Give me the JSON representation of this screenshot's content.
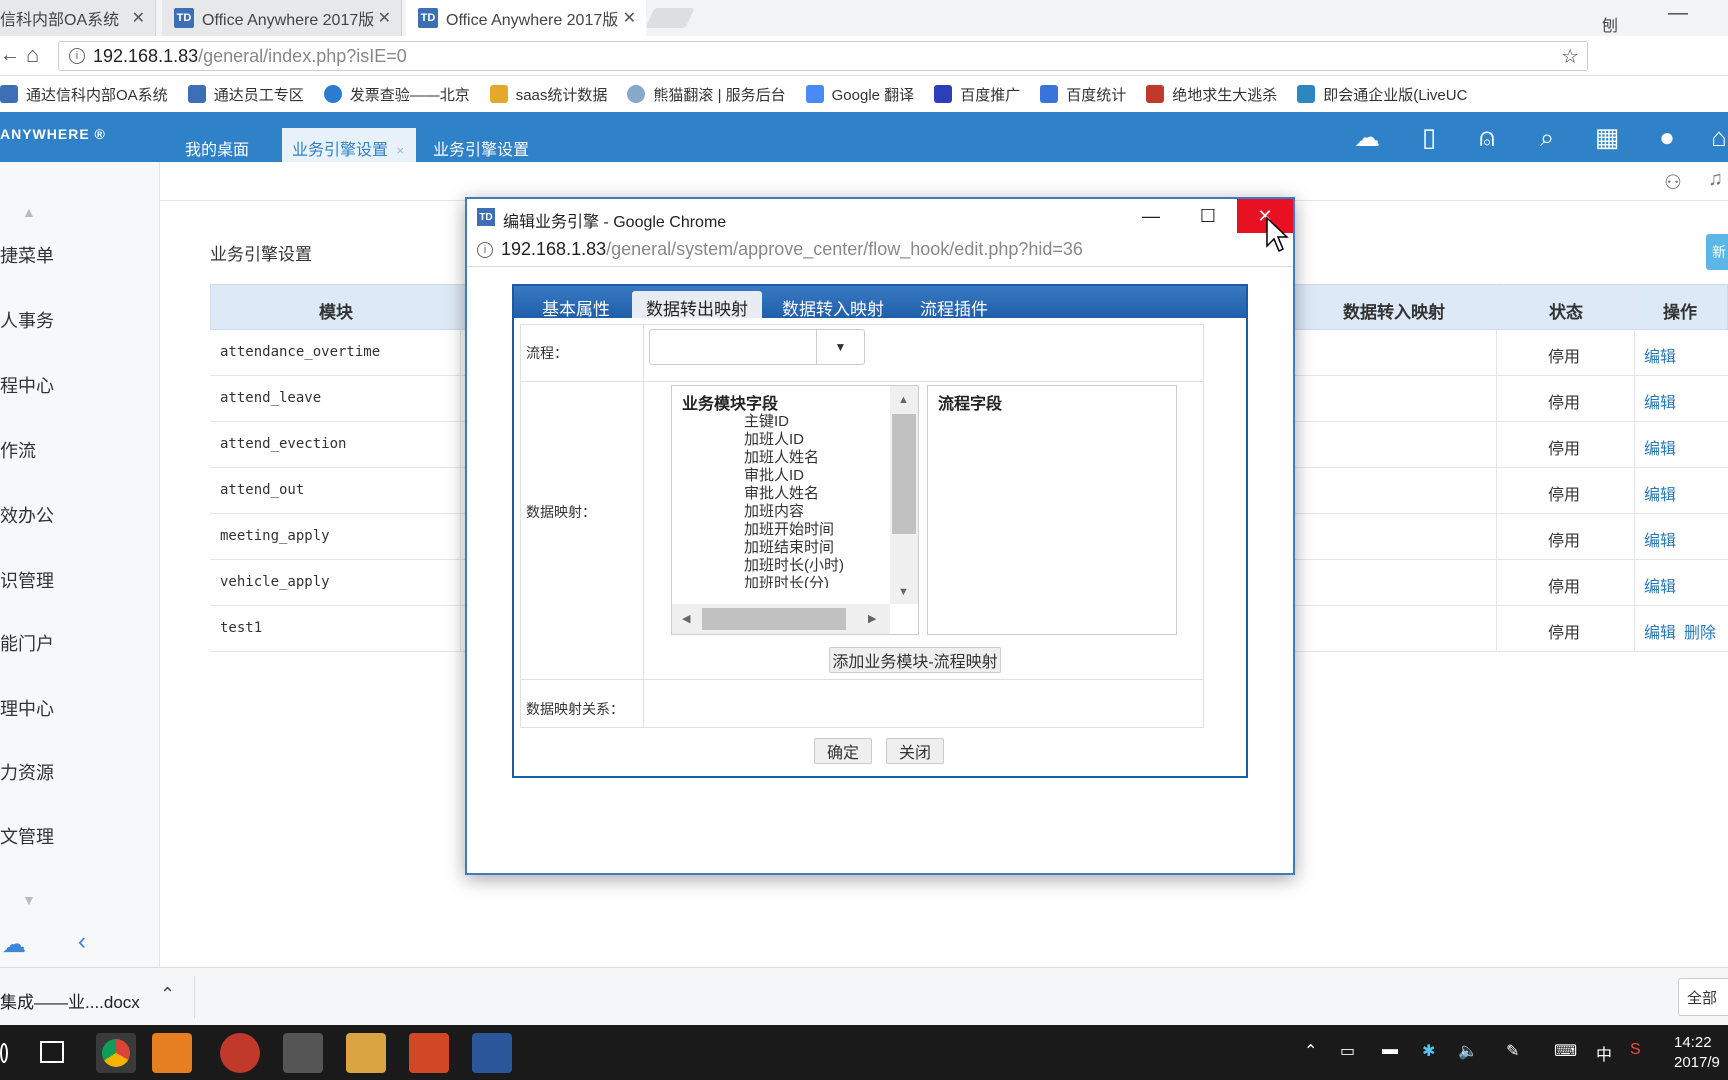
{
  "browser": {
    "tabs": [
      {
        "title": "信科内部OA系统",
        "active": false
      },
      {
        "title": "Office Anywhere 2017版",
        "active": false
      },
      {
        "title": "Office Anywhere 2017版",
        "active": true
      }
    ],
    "url_host": "192.168.1.83",
    "url_path": "/general/index.php?isIE=0",
    "bookmarks": [
      "通达信科内部OA系统",
      "通达员工专区",
      "发票查验——北京",
      "saas统计数据",
      "熊猫翻滚 | 服务后台",
      "Google 翻译",
      "百度推广",
      "百度统计",
      "绝地求生大逃杀",
      "即会通企业版(LiveUC"
    ],
    "user_fragment": "刨"
  },
  "oa": {
    "logo": "ANYWHERE ®",
    "nav_tabs": [
      "我的桌面",
      "业务引擎设置",
      "业务引擎设置"
    ],
    "sidebar_items": [
      "捷菜单",
      "人事务",
      "程中心",
      "作流",
      "效办公",
      "识管理",
      "能门户",
      "理中心",
      "力资源",
      "文管理"
    ],
    "content_title": "业务引擎设置",
    "table_headers": {
      "module": "模块",
      "import_mapping": "数据转入映射",
      "status": "状态",
      "actions": "操作"
    },
    "rows": [
      {
        "module": "attendance_overtime",
        "status": "停用",
        "edit": "编辑"
      },
      {
        "module": "attend_leave",
        "status": "停用",
        "edit": "编辑"
      },
      {
        "module": "attend_evection",
        "status": "停用",
        "edit": "编辑"
      },
      {
        "module": "attend_out",
        "status": "停用",
        "edit": "编辑"
      },
      {
        "module": "meeting_apply",
        "status": "停用",
        "edit": "编辑"
      },
      {
        "module": "vehicle_apply",
        "status": "停用",
        "edit": "编辑"
      },
      {
        "module": "test1",
        "status": "停用",
        "edit": "编辑",
        "delete": "删除"
      }
    ],
    "right_edge_button": "新"
  },
  "popup": {
    "title": "编辑业务引擎 - Google Chrome",
    "url_host": "192.168.1.83",
    "url_path": "/general/system/approve_center/flow_hook/edit.php?hid=36",
    "tabs": [
      "基本属性",
      "数据转出映射",
      "数据转入映射",
      "流程插件"
    ],
    "active_tab": "数据转出映射",
    "labels": {
      "flow": "流程：",
      "data_mapping": "数据映射：",
      "mapping_relation": "数据映射关系："
    },
    "module_fields_header": "业务模块字段",
    "module_fields": [
      "主键ID",
      "加班人ID",
      "加班人姓名",
      "审批人ID",
      "审批人姓名",
      "加班内容",
      "加班开始时间",
      "加班结束时间",
      "加班时长(小时)",
      "加班时长(分)"
    ],
    "flow_fields_header": "流程字段",
    "add_mapping_button": "添加业务模块-流程映射",
    "ok_button": "确定",
    "close_button": "关闭"
  },
  "download_bar": {
    "filename": "集成——业....docx",
    "show_all": "全部"
  },
  "taskbar": {
    "time": "14:22",
    "date": "2017/9",
    "ime": "中"
  }
}
